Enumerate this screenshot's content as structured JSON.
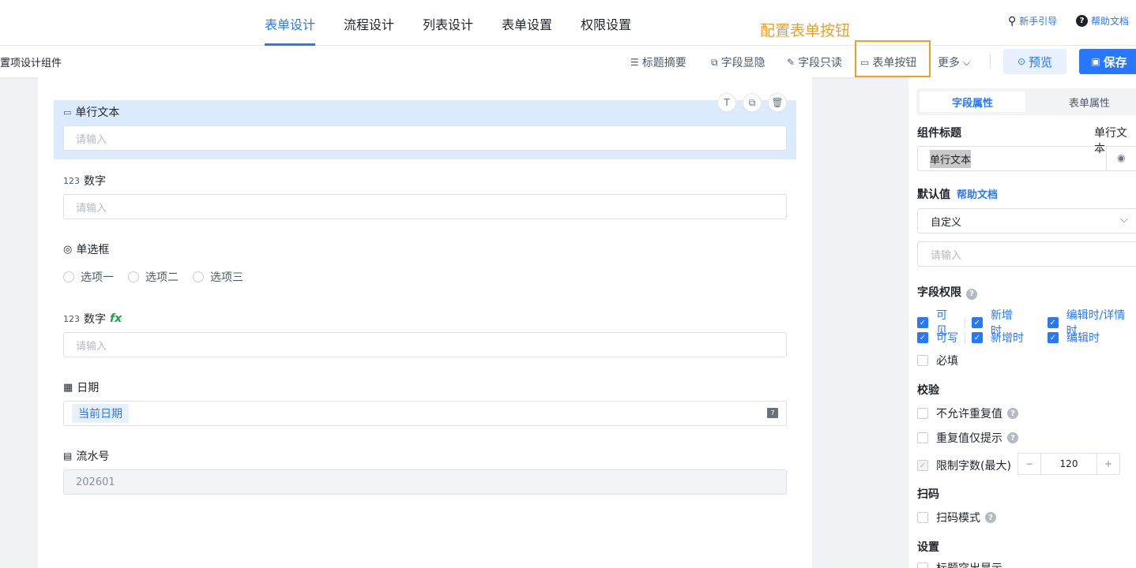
{
  "nav": {
    "tabs": [
      "表单设计",
      "流程设计",
      "列表设计",
      "表单设置",
      "权限设置"
    ],
    "guide": "新手引导",
    "help": "帮助文档"
  },
  "annotation": "配置表单按钮",
  "toolbar": {
    "left_label": "置项设计组件",
    "title_summary": "标题摘要",
    "field_visibility": "字段显隐",
    "field_readonly": "字段只读",
    "form_buttons": "表单按钮",
    "more": "更多",
    "preview": "预览",
    "save": "保存"
  },
  "fields": {
    "single_text": {
      "label": "单行文本",
      "placeholder": "请输入"
    },
    "number": {
      "label": "数字",
      "placeholder": "请输入"
    },
    "radio": {
      "label": "单选框",
      "options": [
        "选项一",
        "选项二",
        "选项三"
      ]
    },
    "number_fx": {
      "label": "数字",
      "fx": "fx",
      "placeholder": "请输入"
    },
    "date": {
      "label": "日期",
      "value": "当前日期"
    },
    "serial": {
      "label": "流水号",
      "value": "202601"
    }
  },
  "panel": {
    "tabs": [
      "字段属性",
      "表单属性"
    ],
    "component_title": "组件标题",
    "component_type": "单行文本",
    "title_value": "单行文本",
    "default_value": "默认值",
    "help_doc": "帮助文档",
    "default_select": "自定义",
    "default_placeholder": "请输入",
    "field_permission": "字段权限",
    "visible": "可见",
    "writable": "可写",
    "on_create": "新增时",
    "on_edit_detail": "编辑时/详情时",
    "on_edit": "编辑时",
    "required": "必填",
    "validation": "校验",
    "no_duplicate": "不允许重复值",
    "duplicate_hint": "重复值仅提示",
    "limit_chars": "限制字数(最大)",
    "limit_value": "120",
    "scan": "扫码",
    "scan_mode": "扫码模式",
    "settings": "设置",
    "title_highlight": "标题突出显示"
  }
}
